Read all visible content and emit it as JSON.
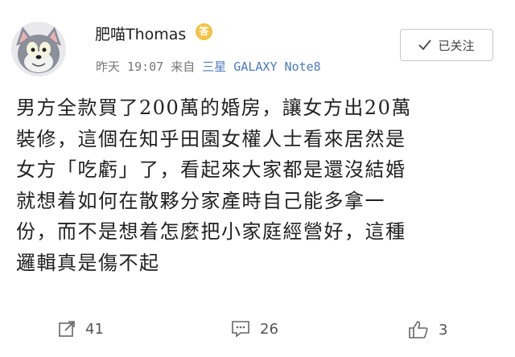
{
  "post": {
    "author": {
      "name": "肥喵Thomas",
      "badge": "答"
    },
    "meta": {
      "day": "昨天",
      "time": "19:07",
      "from": "来自",
      "device": "三星 GALAXY Note8"
    },
    "follow_label": "已关注",
    "content_lines": [
      "男方全款買了200萬的婚房，讓女方出20萬",
      "裝修，這個在知乎田園女權人士看來居然是",
      "女方「吃虧」了，看起來大家都是還沒結婚",
      "就想着如何在散夥分家產時自己能多拿一",
      "份，而不是想着怎麼把小家庭經營好，這種",
      "邏輯真是傷不起"
    ],
    "actions": {
      "repost_count": "41",
      "comment_count": "26",
      "like_count": "3"
    }
  },
  "colors": {
    "source_link": "#4a7abf",
    "badge": "#f3c243"
  }
}
